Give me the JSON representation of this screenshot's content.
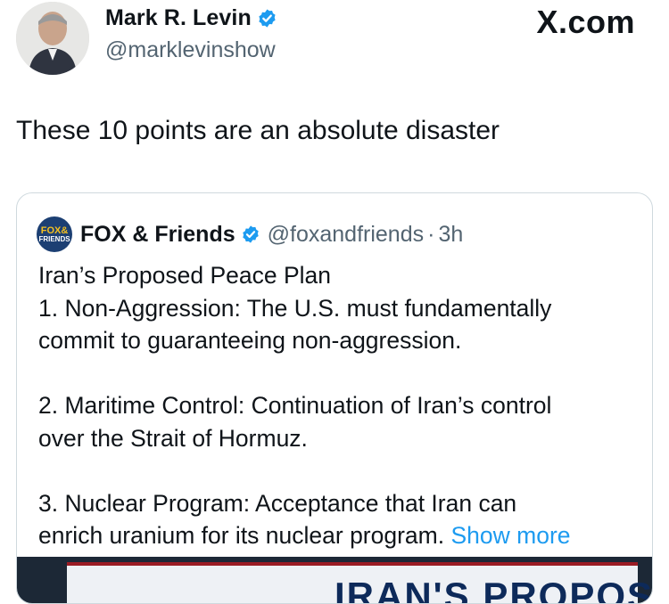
{
  "author": {
    "name": "Mark R. Levin",
    "handle": "@marklevinshow",
    "verified": true
  },
  "brand": {
    "label": "X.com"
  },
  "tweet": {
    "text": "These 10 points are an absolute disaster"
  },
  "quote": {
    "avatar_text_top": "FOX&",
    "avatar_text_bottom": "FRIENDS",
    "name": "FOX & Friends",
    "handle": "@foxandfriends",
    "separator": "·",
    "time": "3h",
    "lines": [
      "Iran’s Proposed Peace Plan",
      "1. Non-Aggression: The U.S. must fundamentally",
      "commit to guaranteeing non-aggression.",
      "2. Maritime Control: Continuation of Iran’s control",
      "over the Strait of Hormuz.",
      "3. Nuclear Program: Acceptance that Iran can",
      "enrich uranium for its nuclear program."
    ],
    "show_more": "Show more",
    "media_caption": "IRAN'S PROPOSED"
  },
  "colors": {
    "verified_badge": "#1d9bf0",
    "link": "#1d9bf0",
    "secondary_text": "#536471"
  }
}
